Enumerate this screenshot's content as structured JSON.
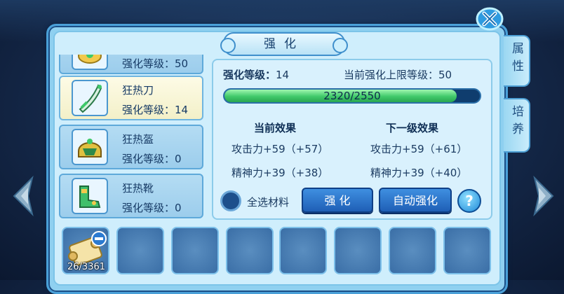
{
  "window": {
    "title": "强化"
  },
  "side_tabs": [
    {
      "label": "属性"
    },
    {
      "label": "培养"
    }
  ],
  "equipment": [
    {
      "name": "",
      "level_text": "强化等级：50",
      "selected": false,
      "icon": "accessory-icon"
    },
    {
      "name": "狂热刀",
      "level_text": "强化等级：14",
      "selected": true,
      "icon": "blade-icon"
    },
    {
      "name": "狂热盔",
      "level_text": "强化等级：0",
      "selected": false,
      "icon": "helmet-icon"
    },
    {
      "name": "狂热靴",
      "level_text": "强化等级：0",
      "selected": false,
      "icon": "boots-icon"
    }
  ],
  "enhance": {
    "level_label": "强化等级：",
    "level_value": "14",
    "max_label": "当前强化上限等级：",
    "max_value": "50",
    "exp_text": "2320/2550",
    "exp_current": 2320,
    "exp_total": 2550,
    "current_header": "当前效果",
    "next_header": "下一级效果",
    "current_effects": [
      "攻击力+59（+57）",
      "精神力+39（+38）"
    ],
    "next_effects": [
      "攻击力+59（+61）",
      "精神力+39（+40）"
    ]
  },
  "controls": {
    "select_all_label": "全选材料",
    "enhance_button": "强 化",
    "auto_enhance_button": "自动强化",
    "help_label": "?"
  },
  "materials": {
    "first_count": "26/3361",
    "slot_count": 8
  },
  "colors": {
    "accent": "#2a72cc",
    "progress": "#3fc96a",
    "frame": "#4aa0d8"
  }
}
